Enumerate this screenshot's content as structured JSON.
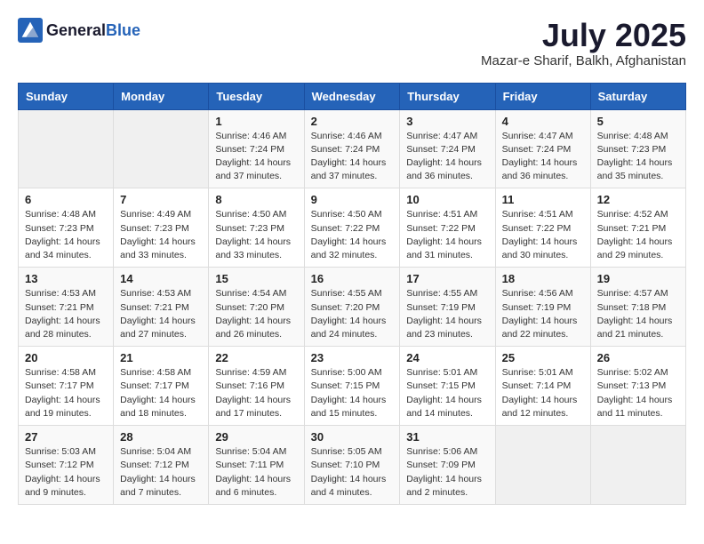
{
  "header": {
    "logo_general": "General",
    "logo_blue": "Blue",
    "title": "July 2025",
    "location": "Mazar-e Sharif, Balkh, Afghanistan"
  },
  "weekdays": [
    "Sunday",
    "Monday",
    "Tuesday",
    "Wednesday",
    "Thursday",
    "Friday",
    "Saturday"
  ],
  "weeks": [
    [
      {
        "day": "",
        "info": ""
      },
      {
        "day": "",
        "info": ""
      },
      {
        "day": "1",
        "info": "Sunrise: 4:46 AM\nSunset: 7:24 PM\nDaylight: 14 hours\nand 37 minutes."
      },
      {
        "day": "2",
        "info": "Sunrise: 4:46 AM\nSunset: 7:24 PM\nDaylight: 14 hours\nand 37 minutes."
      },
      {
        "day": "3",
        "info": "Sunrise: 4:47 AM\nSunset: 7:24 PM\nDaylight: 14 hours\nand 36 minutes."
      },
      {
        "day": "4",
        "info": "Sunrise: 4:47 AM\nSunset: 7:24 PM\nDaylight: 14 hours\nand 36 minutes."
      },
      {
        "day": "5",
        "info": "Sunrise: 4:48 AM\nSunset: 7:23 PM\nDaylight: 14 hours\nand 35 minutes."
      }
    ],
    [
      {
        "day": "6",
        "info": "Sunrise: 4:48 AM\nSunset: 7:23 PM\nDaylight: 14 hours\nand 34 minutes."
      },
      {
        "day": "7",
        "info": "Sunrise: 4:49 AM\nSunset: 7:23 PM\nDaylight: 14 hours\nand 33 minutes."
      },
      {
        "day": "8",
        "info": "Sunrise: 4:50 AM\nSunset: 7:23 PM\nDaylight: 14 hours\nand 33 minutes."
      },
      {
        "day": "9",
        "info": "Sunrise: 4:50 AM\nSunset: 7:22 PM\nDaylight: 14 hours\nand 32 minutes."
      },
      {
        "day": "10",
        "info": "Sunrise: 4:51 AM\nSunset: 7:22 PM\nDaylight: 14 hours\nand 31 minutes."
      },
      {
        "day": "11",
        "info": "Sunrise: 4:51 AM\nSunset: 7:22 PM\nDaylight: 14 hours\nand 30 minutes."
      },
      {
        "day": "12",
        "info": "Sunrise: 4:52 AM\nSunset: 7:21 PM\nDaylight: 14 hours\nand 29 minutes."
      }
    ],
    [
      {
        "day": "13",
        "info": "Sunrise: 4:53 AM\nSunset: 7:21 PM\nDaylight: 14 hours\nand 28 minutes."
      },
      {
        "day": "14",
        "info": "Sunrise: 4:53 AM\nSunset: 7:21 PM\nDaylight: 14 hours\nand 27 minutes."
      },
      {
        "day": "15",
        "info": "Sunrise: 4:54 AM\nSunset: 7:20 PM\nDaylight: 14 hours\nand 26 minutes."
      },
      {
        "day": "16",
        "info": "Sunrise: 4:55 AM\nSunset: 7:20 PM\nDaylight: 14 hours\nand 24 minutes."
      },
      {
        "day": "17",
        "info": "Sunrise: 4:55 AM\nSunset: 7:19 PM\nDaylight: 14 hours\nand 23 minutes."
      },
      {
        "day": "18",
        "info": "Sunrise: 4:56 AM\nSunset: 7:19 PM\nDaylight: 14 hours\nand 22 minutes."
      },
      {
        "day": "19",
        "info": "Sunrise: 4:57 AM\nSunset: 7:18 PM\nDaylight: 14 hours\nand 21 minutes."
      }
    ],
    [
      {
        "day": "20",
        "info": "Sunrise: 4:58 AM\nSunset: 7:17 PM\nDaylight: 14 hours\nand 19 minutes."
      },
      {
        "day": "21",
        "info": "Sunrise: 4:58 AM\nSunset: 7:17 PM\nDaylight: 14 hours\nand 18 minutes."
      },
      {
        "day": "22",
        "info": "Sunrise: 4:59 AM\nSunset: 7:16 PM\nDaylight: 14 hours\nand 17 minutes."
      },
      {
        "day": "23",
        "info": "Sunrise: 5:00 AM\nSunset: 7:15 PM\nDaylight: 14 hours\nand 15 minutes."
      },
      {
        "day": "24",
        "info": "Sunrise: 5:01 AM\nSunset: 7:15 PM\nDaylight: 14 hours\nand 14 minutes."
      },
      {
        "day": "25",
        "info": "Sunrise: 5:01 AM\nSunset: 7:14 PM\nDaylight: 14 hours\nand 12 minutes."
      },
      {
        "day": "26",
        "info": "Sunrise: 5:02 AM\nSunset: 7:13 PM\nDaylight: 14 hours\nand 11 minutes."
      }
    ],
    [
      {
        "day": "27",
        "info": "Sunrise: 5:03 AM\nSunset: 7:12 PM\nDaylight: 14 hours\nand 9 minutes."
      },
      {
        "day": "28",
        "info": "Sunrise: 5:04 AM\nSunset: 7:12 PM\nDaylight: 14 hours\nand 7 minutes."
      },
      {
        "day": "29",
        "info": "Sunrise: 5:04 AM\nSunset: 7:11 PM\nDaylight: 14 hours\nand 6 minutes."
      },
      {
        "day": "30",
        "info": "Sunrise: 5:05 AM\nSunset: 7:10 PM\nDaylight: 14 hours\nand 4 minutes."
      },
      {
        "day": "31",
        "info": "Sunrise: 5:06 AM\nSunset: 7:09 PM\nDaylight: 14 hours\nand 2 minutes."
      },
      {
        "day": "",
        "info": ""
      },
      {
        "day": "",
        "info": ""
      }
    ]
  ]
}
